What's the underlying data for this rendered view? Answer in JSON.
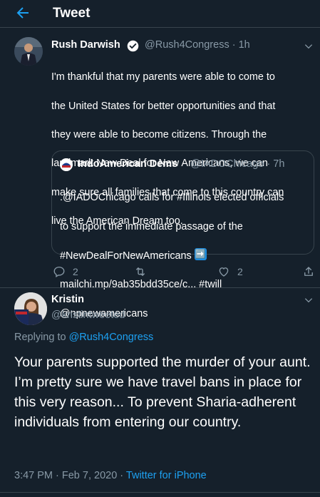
{
  "header": {
    "title": "Tweet"
  },
  "tweet": {
    "name": "Rush Darwish",
    "handle": "@Rush4Congress",
    "time": "· 1h",
    "lines": [
      "I'm thankful that my parents were able to come to",
      "the United States for better opportunities and that",
      "they were able to become citizens. Through the",
      "landmark New Deal for New Americans, we can",
      "make sure all families that come to this country can",
      "live the American Dream too."
    ],
    "reply_count": "2",
    "like_count": "2"
  },
  "quote": {
    "name": "IndoAmerican Dems",
    "handle": "@IADOChicago",
    "time": "· 7h",
    "line1": ".@IADOChicago calls for #Illinois elected officials",
    "line2": "to support the immediate passage of the",
    "line3": "#NewDealForNewAmericans",
    "arrow": "➡️",
    "line4": "mailchi.mp/9ab35bdd35ce/c... #twill",
    "line5": "@npnewamericans"
  },
  "reply": {
    "name": "Kristin",
    "handle": "@kristintweeted",
    "replying_label": "Replying to",
    "replying_to": "@Rush4Congress",
    "text": "Your parents supported the murder of your aunt. I’m pretty sure we have travel bans in place for this very reason... To prevent Sharia-adherent individuals from entering our country.",
    "time": "3:47 PM · Feb 7, 2020 ·",
    "source": "Twitter for iPhone"
  },
  "colors": {
    "background": "#15202b",
    "accent": "#1da1f2",
    "muted": "#8899a6",
    "border": "#38444d"
  }
}
